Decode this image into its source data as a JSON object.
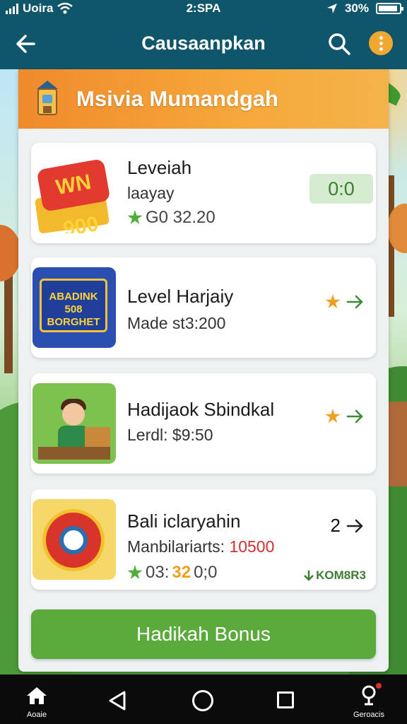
{
  "status_bar": {
    "carrier": "Uoira",
    "time": "2:SPA",
    "battery": "30%"
  },
  "app_bar": {
    "title": "Causaanpkan"
  },
  "header": {
    "title": "Msivia Mumandgah"
  },
  "offers": [
    {
      "name": "Leveiah",
      "subtitle": "laayay",
      "rating_text": "G0 32.20",
      "badge": "0:0",
      "thumb_text": "WN 900"
    },
    {
      "name": "Level Harjaiy",
      "subtitle": "Made st3:200",
      "thumb_text": "ABADINK 508 BORGHET"
    },
    {
      "name": "Hadijaok Sbindkal",
      "subtitle": "Lerdl: $9:50"
    },
    {
      "name": "Bali iclaryahin",
      "subtitle_label": "Manbilariarts:",
      "subtitle_value": "10500",
      "rating_prefix": "03:",
      "rating_highlight": "32",
      "rating_suffix": "0;0",
      "count": "2",
      "bonus_tag": "KOM8R3"
    }
  ],
  "cta": {
    "label": "Hadikah Bonus"
  },
  "nav": {
    "home_label": "Aoaie",
    "right_label": "Geroacis"
  },
  "colors": {
    "app_bar": "#10566b",
    "header_orange": "#f08a2c",
    "accent_green": "#5aaa3c",
    "badge_green": "#d5ecd0",
    "star_orange": "#f0a020",
    "value_red": "#d32f2f"
  },
  "icons": [
    "back-arrow-icon",
    "search-icon",
    "more-vert-icon",
    "star-icon",
    "arrow-right-icon",
    "home-icon",
    "nav-back-icon",
    "nav-home-icon",
    "nav-recent-icon",
    "location-pin-icon"
  ]
}
